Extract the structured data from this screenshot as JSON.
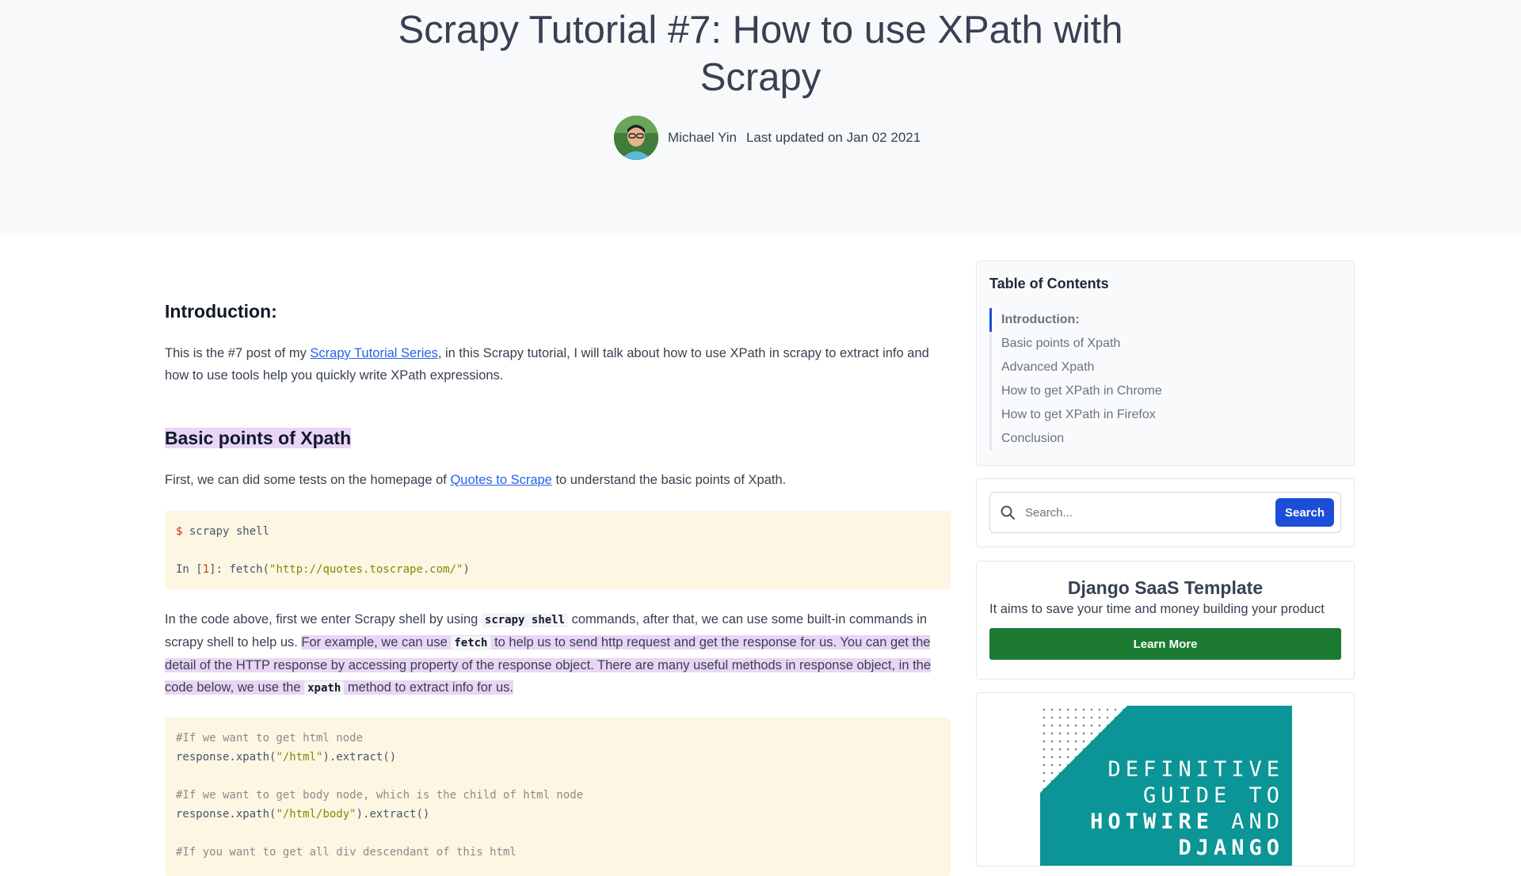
{
  "page": {
    "title": "Scrapy Tutorial #7: How to use XPath with Scrapy",
    "author": "Michael Yin",
    "updated": "Last updated on Jan 02 2021"
  },
  "article": {
    "intro_heading": "Introduction:",
    "intro_p1": "This is the #7 post of my ",
    "intro_link": "Scrapy Tutorial Series",
    "intro_p2": ", in this Scrapy tutorial, I will talk about how to use XPath in scrapy to extract info and how to use tools help you quickly write XPath expressions.",
    "basic_heading": "Basic points of Xpath",
    "basic_p1": "First, we can did some tests on the homepage of ",
    "basic_link": "Quotes to Scrape",
    "basic_p2": " to understand the basic points of Xpath.",
    "code1": {
      "prompt": "$",
      "cmd": " scrapy shell",
      "in_prefix": "In [",
      "in_num": "1",
      "in_suffix": "]: fetch(",
      "url": "\"http://quotes.toscrape.com/\"",
      "close": ")"
    },
    "para2_a": "In the code above, first we enter Scrapy shell by using ",
    "para2_code1": "scrapy shell",
    "para2_b": " commands, after that, we can use some built-in commands in scrapy shell to help us. ",
    "para2_hl1": "For example, we can use ",
    "para2_code2": "fetch",
    "para2_hl2": " to help us to send http request and get the response for us. You can get the detail of the HTTP response by accessing property of the response object. There are many useful methods in response object, in the code below, we use the ",
    "para2_code3": "xpath",
    "para2_hl3": " method to extract info for us.",
    "code2": {
      "c1": "#If we want to get html node",
      "l1a": "response.xpath(",
      "l1s": "\"/html\"",
      "l1b": ").extract()",
      "c2": "#If we want to get body node, which is the child of html node",
      "l2a": "response.xpath(",
      "l2s": "\"/html/body\"",
      "l2b": ").extract()",
      "c3": "#If you want to get all div descendant of this html"
    }
  },
  "sidebar": {
    "toc_title": "Table of Contents",
    "toc": [
      {
        "label": "Introduction:"
      },
      {
        "label": "Basic points of Xpath"
      },
      {
        "label": "Advanced Xpath"
      },
      {
        "label": "How to get XPath in Chrome"
      },
      {
        "label": "How to get XPath in Firefox"
      },
      {
        "label": "Conclusion"
      }
    ],
    "search_placeholder": "Search...",
    "search_button": "Search",
    "promo_title": "Django SaaS Template",
    "promo_text": "It aims to save your time and money building your product",
    "promo_button": "Learn More",
    "book_line1": "DEFINITIVE",
    "book_line2": "GUIDE TO",
    "book_line3a": "HOTWIRE",
    "book_line3b": " AND",
    "book_line4": "DJANGO"
  },
  "colors": {
    "accent": "#1d4ed8",
    "highlight": "#e9d5f5",
    "promo_button": "#1c7a33",
    "book_cover": "#0b9597"
  }
}
